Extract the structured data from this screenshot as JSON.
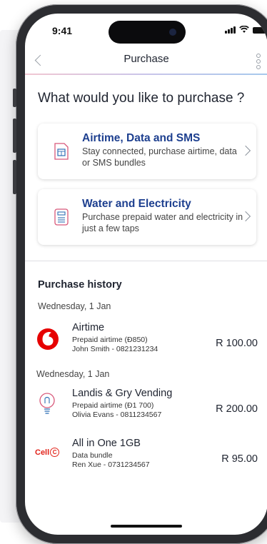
{
  "status_bar": {
    "time": "9:41"
  },
  "nav": {
    "title": "Purchase"
  },
  "heading": "What would you like to purchase ?",
  "options": [
    {
      "title": "Airtime, Data and SMS",
      "subtitle": "Stay connected, purchase airtime, data or SMS bundles",
      "icon": "sim-card-icon"
    },
    {
      "title": "Water and Electricity",
      "subtitle": "Purchase prepaid water and electricity in just a few taps",
      "icon": "meter-icon"
    }
  ],
  "history": {
    "title": "Purchase history",
    "groups": [
      {
        "date": "Wednesday, 1 Jan",
        "items": [
          {
            "name": "Airtime",
            "desc": "Prepaid airtime (Ð850)",
            "person": "John Smith - 0821231234",
            "amount": "R 100.00",
            "logo": "vodafone-logo"
          }
        ]
      },
      {
        "date": "Wednesday, 1 Jan",
        "items": [
          {
            "name": "Landis & Gry Vending",
            "desc": "Prepaid airtime (Ð1 700)",
            "person": "Olivia Evans - 0811234567",
            "amount": "R 200.00",
            "logo": "lightbulb-icon"
          },
          {
            "name": "All in One 1GB",
            "desc": "Data bundle",
            "person": "Ren Xue - 0731234567",
            "amount": "R 95.00",
            "logo": "cellc-logo",
            "logo_text": "Cell"
          }
        ]
      }
    ]
  },
  "colors": {
    "accent_blue": "#1d3f8f",
    "vodafone_red": "#e60000",
    "cellc_red": "#e2231a"
  }
}
